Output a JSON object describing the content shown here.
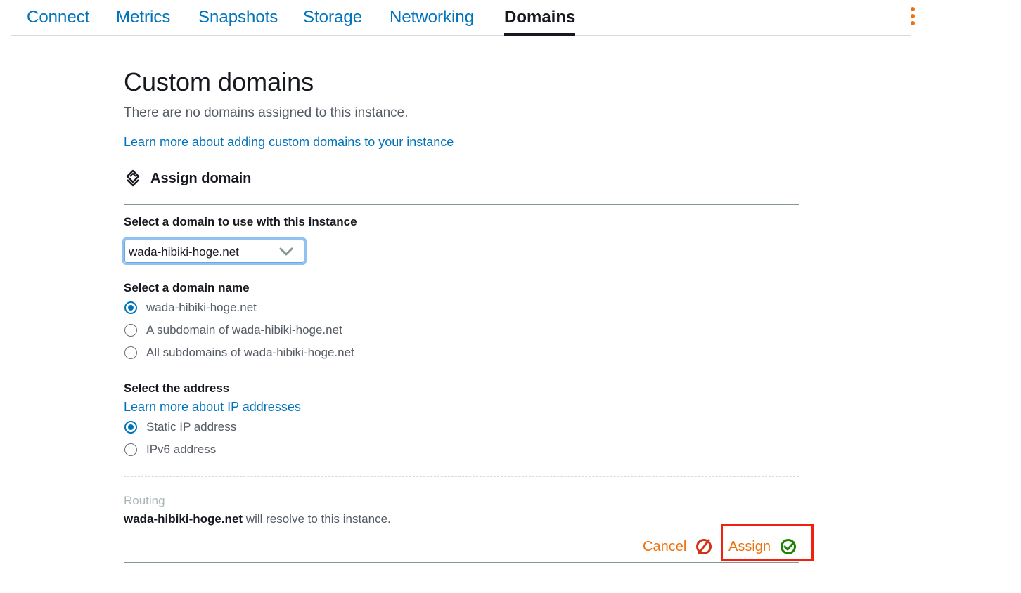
{
  "tabs": {
    "connect": "Connect",
    "metrics": "Metrics",
    "snapshots": "Snapshots",
    "storage": "Storage",
    "networking": "Networking",
    "domains": "Domains",
    "active": "Domains",
    "more_icon": "kebab-menu-icon"
  },
  "page": {
    "title": "Custom domains",
    "description": "There are no domains assigned to this instance.",
    "learn_more_domains": "Learn more about adding custom domains to your instance"
  },
  "assign": {
    "section_title": "Assign domain",
    "section_icon": "domain-icon",
    "select_domain_label": "Select a domain to use with this instance",
    "selected_domain": "wada-hibiki-hoge.net",
    "domain_name_label": "Select a domain name",
    "domain_options": [
      {
        "label": "wada-hibiki-hoge.net",
        "checked": true
      },
      {
        "label": "A subdomain of wada-hibiki-hoge.net",
        "checked": false
      },
      {
        "label": "All subdomains of wada-hibiki-hoge.net",
        "checked": false
      }
    ],
    "address_label": "Select the address",
    "learn_more_ip": "Learn more about IP addresses",
    "address_options": [
      {
        "label": "Static IP address",
        "checked": true
      },
      {
        "label": "IPv6 address",
        "checked": false
      }
    ],
    "routing_label": "Routing",
    "routing_domain": "wada-hibiki-hoge.net",
    "routing_suffix": " will resolve to this instance.",
    "cancel_label": "Cancel",
    "assign_label": "Assign"
  },
  "colors": {
    "link": "#0073bb",
    "accent": "#ec7211",
    "cancel_icon": "#d13212",
    "assign_icon": "#1d8102",
    "highlight": "#f0220f"
  }
}
